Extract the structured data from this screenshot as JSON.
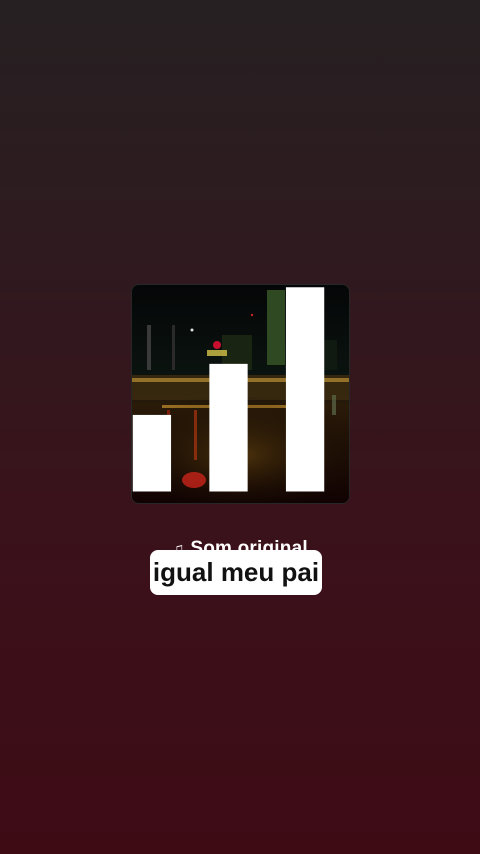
{
  "track": {
    "title": "Som original",
    "note_icon": "music-note-icon"
  },
  "caption": {
    "text": "igual meu pai"
  },
  "cover": {
    "icon": "audio-bars-icon"
  },
  "colors": {
    "background_top": "#262022",
    "background_bottom": "#3e0b15",
    "sticker_bg": "#ffffff",
    "sticker_text": "#111111"
  }
}
